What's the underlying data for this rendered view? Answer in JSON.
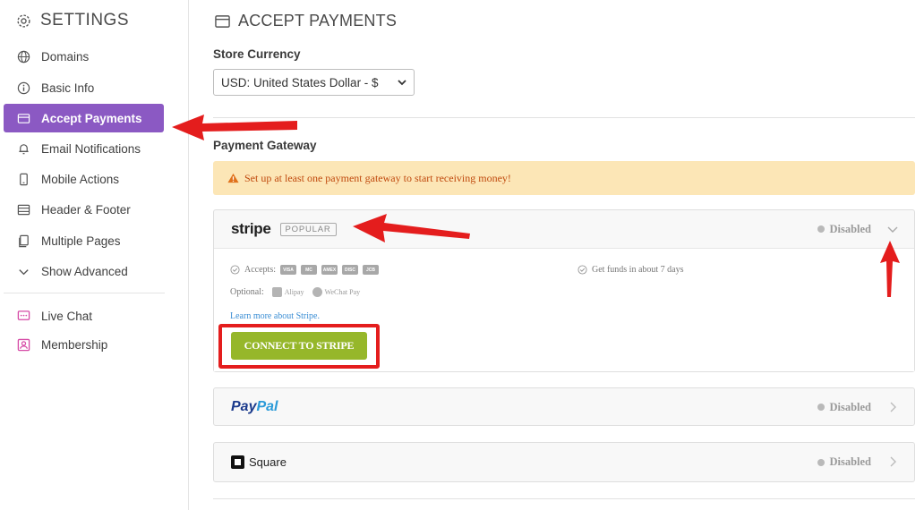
{
  "sidebar": {
    "title": "SETTINGS",
    "items": [
      {
        "label": "Domains",
        "icon": "globe-icon"
      },
      {
        "label": "Basic Info",
        "icon": "info-icon"
      },
      {
        "label": "Accept Payments",
        "icon": "card-icon",
        "active": true
      },
      {
        "label": "Email Notifications",
        "icon": "bell-icon"
      },
      {
        "label": "Mobile Actions",
        "icon": "mobile-icon"
      },
      {
        "label": "Header & Footer",
        "icon": "layout-icon"
      },
      {
        "label": "Multiple Pages",
        "icon": "pages-icon"
      },
      {
        "label": "Show Advanced",
        "icon": "chevron-down-icon"
      }
    ],
    "extras": [
      {
        "label": "Live Chat",
        "icon": "chat-icon"
      },
      {
        "label": "Membership",
        "icon": "member-icon"
      }
    ]
  },
  "main": {
    "title": "ACCEPT PAYMENTS",
    "currency_label": "Store Currency",
    "currency_value": "USD: United States Dollar - $",
    "gateway_label": "Payment Gateway",
    "alert_text": "Set up at least one payment gateway to start receiving money!",
    "gateways": {
      "stripe": {
        "logo": "stripe",
        "badge": "POPULAR",
        "status": "Disabled",
        "accepts_label": "Accepts:",
        "cards": [
          "VISA",
          "MC",
          "AMEX",
          "DISC",
          "JCB"
        ],
        "optional_label": "Optional:",
        "optional_methods": [
          "Alipay",
          "WeChat Pay"
        ],
        "funds_text": "Get funds in about 7 days",
        "learn_more": "Learn more about Stripe.",
        "connect_label": "CONNECT TO STRIPE"
      },
      "paypal": {
        "logo_part1": "Pay",
        "logo_part2": "Pal",
        "status": "Disabled"
      },
      "square": {
        "logo": "Square",
        "status": "Disabled"
      }
    }
  },
  "colors": {
    "active_nav": "#8b59c3",
    "connect_button": "#96b72a",
    "alert_bg": "#fce6b6",
    "alert_text": "#c04a0e",
    "annotation_red": "#e41d1d"
  }
}
